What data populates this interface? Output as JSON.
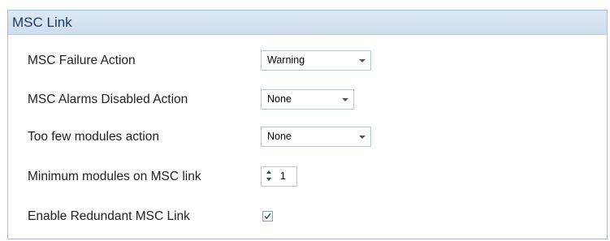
{
  "panel": {
    "title": "MSC Link"
  },
  "fields": {
    "failure_action": {
      "label": "MSC Failure Action",
      "value": "Warning"
    },
    "alarms_disabled_action": {
      "label": "MSC Alarms Disabled Action",
      "value": "None"
    },
    "too_few_modules_action": {
      "label": "Too few modules action",
      "value": "None"
    },
    "minimum_modules": {
      "label": "Minimum modules on MSC link",
      "value": "1"
    },
    "enable_redundant": {
      "label": "Enable Redundant MSC Link",
      "checked": true
    }
  },
  "colors": {
    "header_bg": "#d6e3f1",
    "header_text": "#1e3a5c",
    "border": "#a9bfd6",
    "check": "#3a5f8a"
  },
  "icons": {
    "dropdown": "chevron-down-icon",
    "spinner_up": "spin-up-icon",
    "spinner_down": "spin-down-icon",
    "check": "check-icon"
  }
}
